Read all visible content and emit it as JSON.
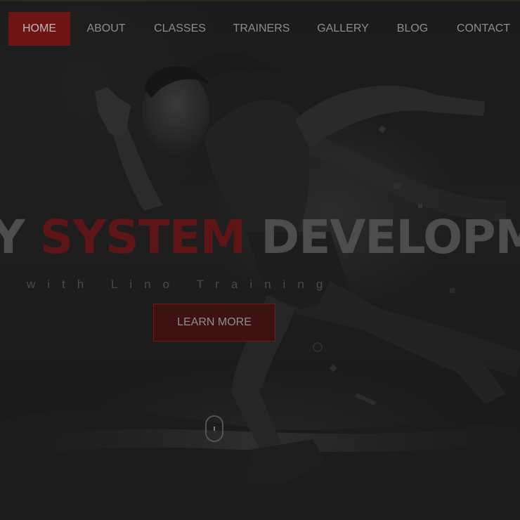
{
  "nav": {
    "items": [
      {
        "label": "HOME",
        "active": true
      },
      {
        "label": "ABOUT",
        "active": false
      },
      {
        "label": "CLASSES",
        "active": false
      },
      {
        "label": "TRAINERS",
        "active": false
      },
      {
        "label": "GALLERY",
        "active": false
      },
      {
        "label": "BLOG",
        "active": false
      },
      {
        "label": "CONTACT",
        "active": false
      }
    ]
  },
  "hero": {
    "headline_start": "Y ",
    "headline_accent": "SYSTEM",
    "headline_end": " DEVELOPME",
    "subline": "with Lino Training",
    "cta_label": "LEARN MORE",
    "scroll_icon": "mouse-scroll-icon"
  },
  "colors": {
    "accent": "#6e1414",
    "background": "#181818",
    "text": "#8c8c8c"
  }
}
